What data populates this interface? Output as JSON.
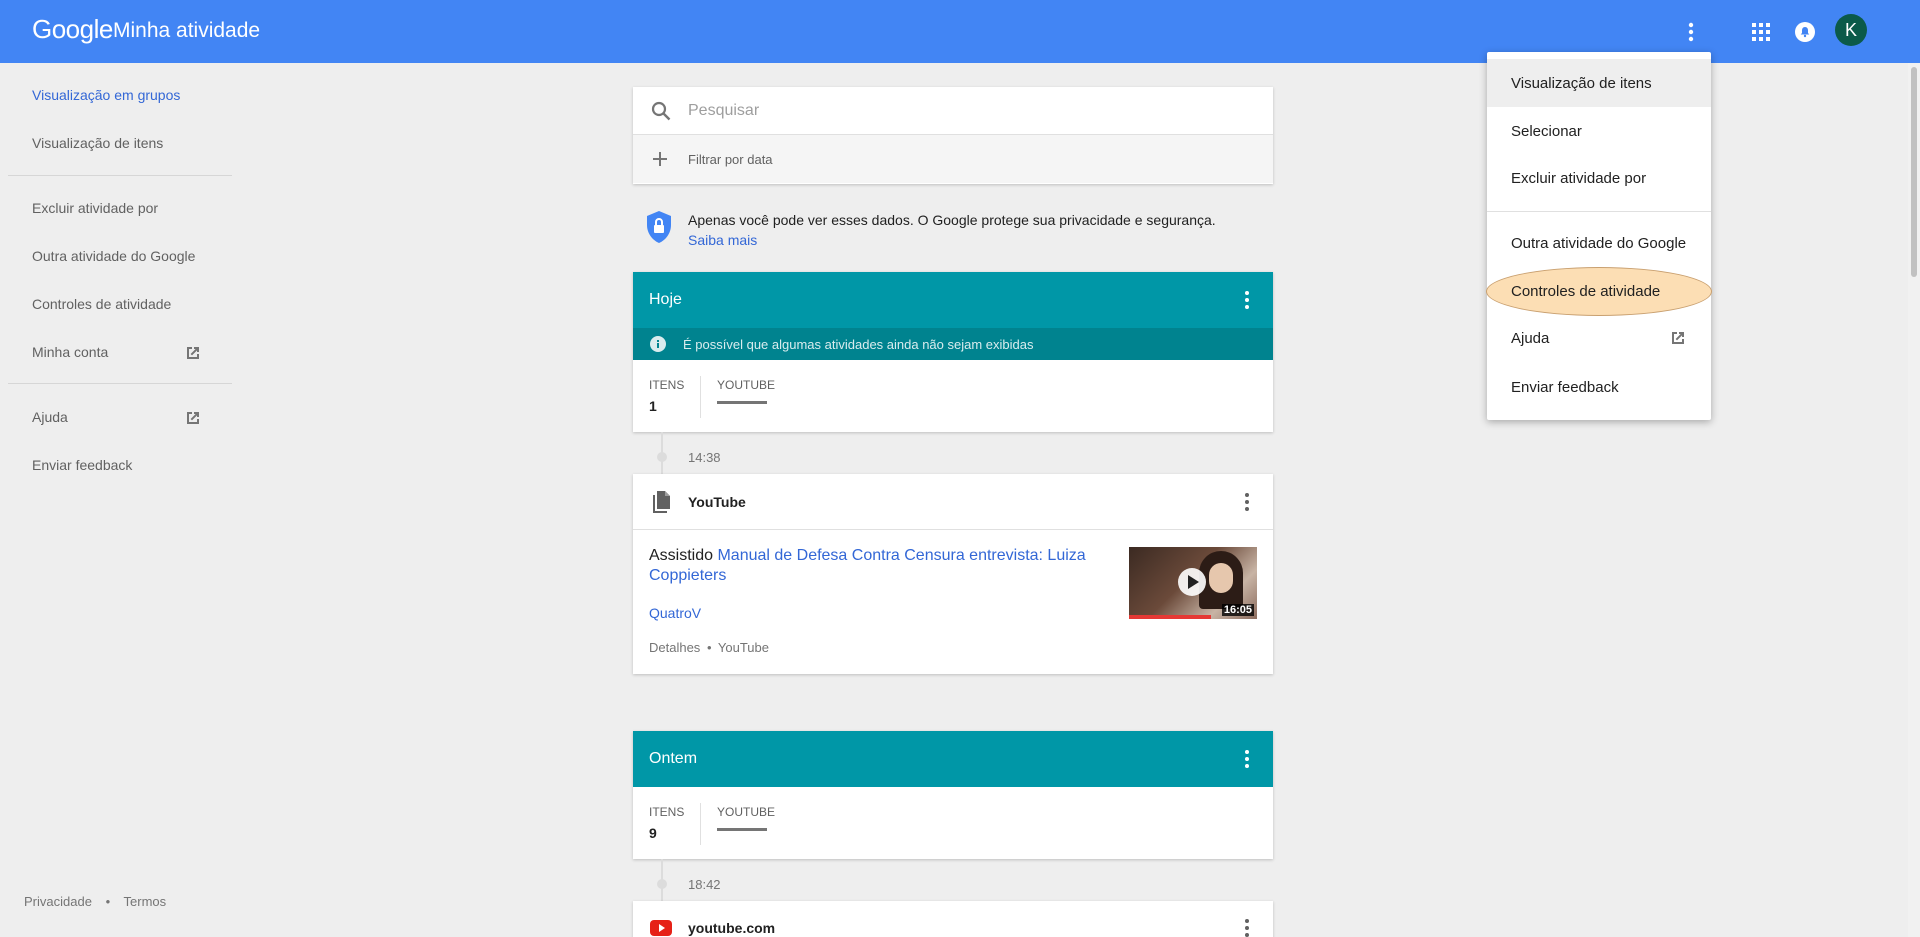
{
  "topbar": {
    "logo": "Google",
    "title": "Minha atividade",
    "avatar_letter": "K",
    "color": "#4285f4"
  },
  "sidebar": {
    "items": [
      {
        "label": "Visualização em grupos"
      },
      {
        "label": "Visualização de itens"
      },
      {
        "label": "Excluir atividade por"
      },
      {
        "label": "Outra atividade do Google"
      },
      {
        "label": "Controles de atividade"
      },
      {
        "label": "Minha conta"
      },
      {
        "label": "Ajuda"
      },
      {
        "label": "Enviar feedback"
      }
    ],
    "footer_privacy": "Privacidade",
    "footer_sep": "•",
    "footer_terms": "Termos"
  },
  "search": {
    "placeholder": "Pesquisar",
    "filter_label": "Filtrar por data"
  },
  "privacy_notice": {
    "text": "Apenas você pode ver esses dados. O Google protege sua privacidade e segurança. ",
    "link": "Saiba mais"
  },
  "today": {
    "header": "Hoje",
    "notice": "É possível que algumas atividades ainda não sejam exibidas",
    "items_label": "ITENS",
    "items_count": "1",
    "source_label": "YOUTUBE",
    "time": "14:38",
    "entry": {
      "product": "YouTube",
      "action": "Assistido ",
      "video_title": "Manual de Defesa Contra Censura entrevista: Luiza Coppieters",
      "channel": "QuatroV",
      "duration": "16:05",
      "details": "Detalhes",
      "dot": "•",
      "source": "YouTube"
    }
  },
  "yesterday": {
    "header": "Ontem",
    "items_label": "ITENS",
    "items_count": "9",
    "source_label": "YOUTUBE",
    "time": "18:42",
    "entry": {
      "product": "youtube.com"
    }
  },
  "menu": {
    "items": [
      {
        "label": "Visualização de itens"
      },
      {
        "label": "Selecionar"
      },
      {
        "label": "Excluir atividade por"
      },
      {
        "label": "Outra atividade do Google"
      },
      {
        "label": "Controles de atividade"
      },
      {
        "label": "Ajuda"
      },
      {
        "label": "Enviar feedback"
      }
    ]
  }
}
